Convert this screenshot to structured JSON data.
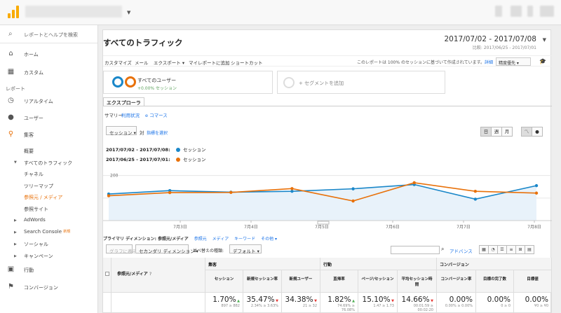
{
  "sidebar": {
    "search_placeholder": "レポートとヘルプを検索",
    "home": "ホーム",
    "custom": "カスタム",
    "section_report": "レポート",
    "realtime": "リアルタイム",
    "user": "ユーザー",
    "acquisition": "集客",
    "overview": "概要",
    "all_traffic": "すべてのトラフィック",
    "channel": "チャネル",
    "treemap": "ツリーマップ",
    "source_medium": "参照元 / メディア",
    "referrals": "参照サイト",
    "adwords": "AdWords",
    "search_console": "Search Console",
    "new_badge": "新規",
    "social": "ソーシャル",
    "campaign": "キャンペーン",
    "behavior": "行動",
    "conversion": "コンバージョン"
  },
  "header": {
    "title": "すべてのトラフィック",
    "date_range": "2017/07/02 - 2017/07/08",
    "compare_range": "比較: 2017/06/25 - 2017/07/01"
  },
  "toolbar": {
    "customize": "カスタマイズ",
    "email": "メール",
    "export": "エクスポート",
    "add_to_my_report": "マイレポートに追加",
    "shortcut": "ショートカット",
    "note": "このレポートは 100% のセッションに基づいて作成されています。",
    "details": "詳細",
    "precision": "精度優先"
  },
  "segments": {
    "all_users": "すべてのユーザー",
    "all_users_pct": "+0.00% セッション",
    "add_segment": "+ セグメントを追加"
  },
  "explorer": {
    "tab": "エクスプローラ",
    "subtabs": [
      "サマリー",
      "利用状況",
      "e コマース"
    ]
  },
  "chart_controls": {
    "metric_select": "セッション",
    "vs": "対",
    "select_metric": "指標を選択",
    "day": "日",
    "week": "週",
    "month": "月"
  },
  "legend": [
    {
      "date": "2017/07/02 - 2017/07/08:",
      "metric": "セッション",
      "color": "#1a87c9"
    },
    {
      "date": "2017/06/25 - 2017/07/01:",
      "metric": "セッション",
      "color": "#e8710a"
    }
  ],
  "chart_data": {
    "type": "line",
    "x": [
      "7月3日",
      "7月4日",
      "7月5日",
      "7月6日",
      "7月7日",
      "7月8日"
    ],
    "y_ticks": [
      100,
      200
    ],
    "series": [
      {
        "color": "#1a87c9",
        "values": [
          118,
          133,
          126,
          130,
          141,
          160,
          95,
          155
        ]
      },
      {
        "color": "#e8710a",
        "values": [
          110,
          124,
          125,
          142,
          87,
          168,
          130,
          122
        ]
      }
    ],
    "ylim": [
      0,
      230
    ]
  },
  "dimension": {
    "primary_label": "プライマリ ディメンション:",
    "primary": "参照元/メディア",
    "options": [
      "参照元",
      "メディア",
      "キーワード",
      "その他 ▾"
    ]
  },
  "table_controls": {
    "plot_rows": "グラフに表示",
    "secondary": "セカンダリ ディメンション ▾",
    "sort_type_label": "並べ替えの種類:",
    "sort_default": "デフォルト ▾",
    "advanced": "アドバンス"
  },
  "table": {
    "groups": {
      "acq": "集客",
      "beh": "行動",
      "conv": "コンバージョン"
    },
    "dim_header": "参照元/メディア",
    "columns": [
      {
        "label": "セッション",
        "value": "1.70%",
        "sub": "897 ≥ 882",
        "trend": "up"
      },
      {
        "label": "新規セッション率",
        "value": "35.47%",
        "sub": "2.34% ≥ 3.63%",
        "trend": "down"
      },
      {
        "label": "新規ユーザー",
        "value": "34.38%",
        "sub": "21 ≥ 32",
        "trend": "down"
      },
      {
        "label": "直帰率",
        "value": "1.82%",
        "sub": "74.69% ≥ 76.08%",
        "trend": "up"
      },
      {
        "label": "ページ/セッション",
        "value": "15.10%",
        "sub": "1.47 ≥ 1.73",
        "trend": "down"
      },
      {
        "label": "平均セッション時間",
        "value": "14.66%",
        "sub": "00:01:59 ≥ 00:02:20",
        "trend": "down"
      },
      {
        "label": "コンバージョン率",
        "value": "0.00%",
        "sub": "0.00% ≥ 0.00%",
        "trend": ""
      },
      {
        "label": "目標の完了数",
        "value": "0.00%",
        "sub": "0 ≥ 0",
        "trend": ""
      },
      {
        "label": "目標値",
        "value": "0.00%",
        "sub": "¥0 ≥ ¥0",
        "trend": ""
      }
    ]
  }
}
